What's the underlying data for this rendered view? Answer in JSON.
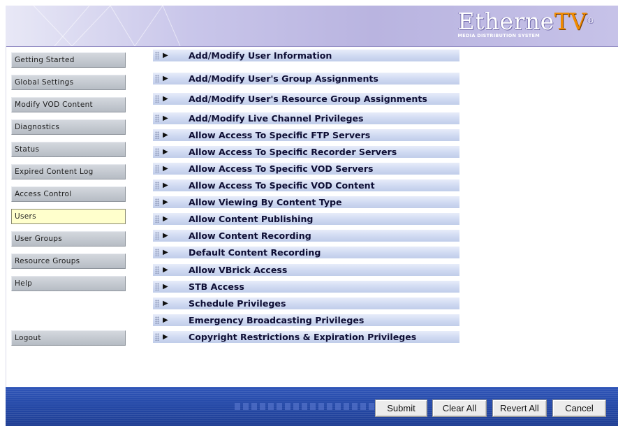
{
  "header": {
    "logo_main": "Etherne",
    "logo_accent": "TV",
    "logo_reg": "®",
    "logo_sub": "MEDIA DISTRIBUTION SYSTEM"
  },
  "sidebar": {
    "items": [
      {
        "label": "Getting Started"
      },
      {
        "label": "Global Settings"
      },
      {
        "label": "Modify VOD Content"
      },
      {
        "label": "Diagnostics"
      },
      {
        "label": "Status"
      },
      {
        "label": "Expired Content Log"
      },
      {
        "label": "Access Control"
      },
      {
        "label": "Users"
      },
      {
        "label": "User Groups"
      },
      {
        "label": "Resource Groups"
      },
      {
        "label": "Help"
      }
    ],
    "active_item": "Users",
    "logout_label": "Logout"
  },
  "privileges": {
    "items": [
      {
        "label": "Add/Modify User Information"
      },
      {
        "label": "Add/Modify User's Group Assignments"
      },
      {
        "label": "Add/Modify User's Resource Group Assignments"
      },
      {
        "label": "Add/Modify Live Channel Privileges"
      },
      {
        "label": "Allow Access To Specific FTP Servers"
      },
      {
        "label": "Allow Access To Specific Recorder Servers"
      },
      {
        "label": "Allow Access To Specific VOD Servers"
      },
      {
        "label": "Allow Access To Specific VOD Content"
      },
      {
        "label": "Allow Viewing By Content Type"
      },
      {
        "label": "Allow Content Publishing"
      },
      {
        "label": "Allow Content Recording"
      },
      {
        "label": "Default Content Recording"
      },
      {
        "label": "Allow VBrick Access"
      },
      {
        "label": "STB Access"
      },
      {
        "label": "Schedule Privileges"
      },
      {
        "label": "Emergency Broadcasting Privileges"
      },
      {
        "label": "Copyright Restrictions & Expiration Privileges"
      }
    ]
  },
  "footer": {
    "submit_label": "Submit",
    "clear_all_label": "Clear All",
    "revert_all_label": "Revert All",
    "cancel_label": "Cancel"
  },
  "colors": {
    "active_nav_bg": "#ffffcc",
    "nav_bg": "#c5cad1",
    "row_bg": "#cfd9f1",
    "footer_bg": "#2448a6",
    "logo_accent": "#f08a00"
  },
  "icons": {
    "row_expand": "triangle-right-icon",
    "row_grip": "grip-dots-icon"
  }
}
